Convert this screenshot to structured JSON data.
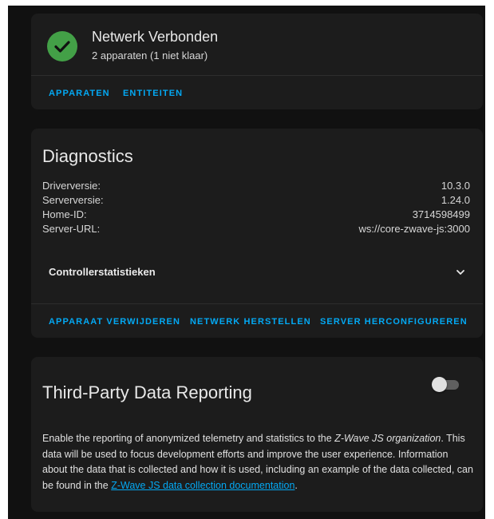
{
  "network_card": {
    "title": "Netwerk Verbonden",
    "subtitle": "2 apparaten (1 niet klaar)",
    "status_icon": "check-circle-icon",
    "status_color": "#43a047",
    "actions": [
      "APPARATEN",
      "ENTITEITEN"
    ]
  },
  "diagnostics_card": {
    "title": "Diagnostics",
    "rows": [
      {
        "label": "Driverversie:",
        "value": "10.3.0"
      },
      {
        "label": "Serverversie:",
        "value": "1.24.0"
      },
      {
        "label": "Home-ID:",
        "value": "3714598499"
      },
      {
        "label": "Server-URL:",
        "value": "ws://core-zwave-js:3000"
      }
    ],
    "expander_label": "Controllerstatistieken",
    "actions": [
      "APPARAAT VERWIJDEREN",
      "NETWERK HERSTELLEN",
      "SERVER HERCONFIGUREREN"
    ]
  },
  "reporting_card": {
    "title": "Third-Party Data Reporting",
    "toggle_on": false,
    "text_1": "Enable the reporting of anonymized telemetry and statistics to the ",
    "org": "Z-Wave JS organization",
    "text_2": ". This data will be used to focus development efforts and improve the user experience. Information about the data that is collected and how it is used, including an example of the data collected, can be found in the ",
    "link": "Z-Wave JS data collection documentation",
    "text_3": "."
  },
  "colors": {
    "accent": "#03a9f4",
    "card_bg": "#1c1c1c",
    "page_bg": "#111111"
  }
}
